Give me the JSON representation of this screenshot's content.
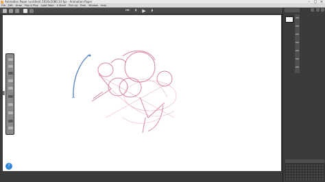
{
  "window": {
    "title": "Animation Paper (untitled) 1920x1080 24 fps - Animation Paper",
    "minimize": "–",
    "maximize": "□",
    "close": "×"
  },
  "menu": {
    "items": [
      "File",
      "Edit",
      "Draw",
      "Play & Plug",
      "Light Table",
      "X Sheet",
      "Pick Up",
      "Pixel",
      "Window",
      "Help"
    ]
  },
  "playback": {
    "first": "⏮",
    "prev": "⏴",
    "play": "▶",
    "next": "⏵"
  },
  "help_button": {
    "label": "?"
  },
  "colors": {
    "sketch": "#d9869a",
    "sketch_light": "#eab6c3",
    "stroke_blue": "#5a86c6",
    "canvas": "#ffffff",
    "chrome": "#3a3a3a"
  }
}
